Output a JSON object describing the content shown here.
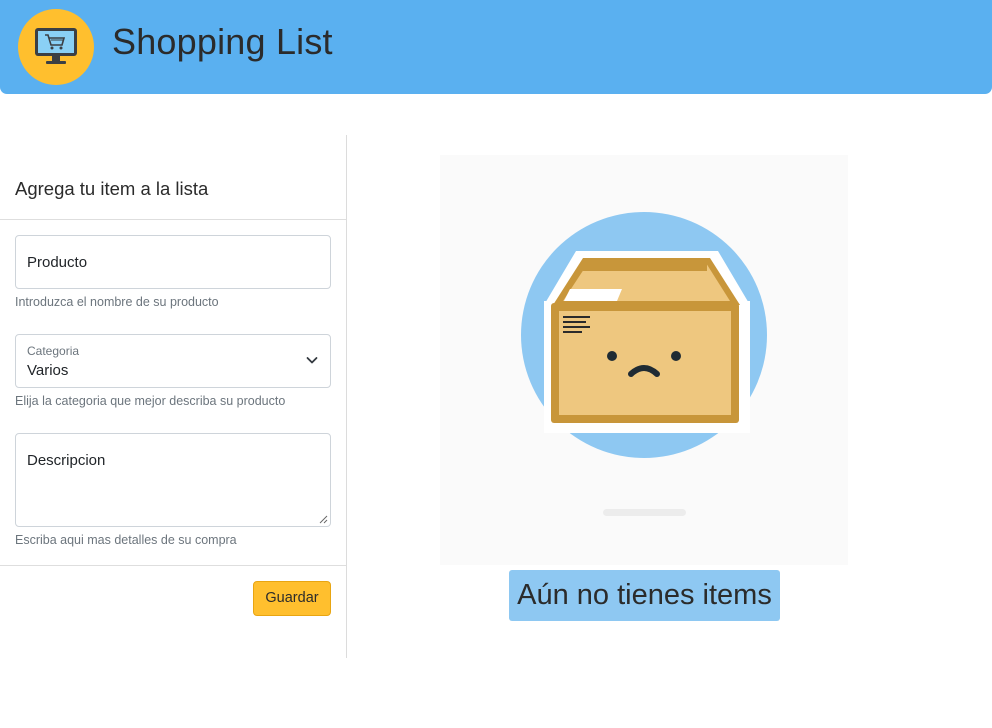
{
  "header": {
    "title": "Shopping List",
    "logo_icon": "shopping-cart-monitor-icon",
    "background_color": "#5ab0f0",
    "logo_color": "#ffbf2e"
  },
  "form": {
    "title": "Agrega tu item a la lista",
    "product": {
      "placeholder": "Producto",
      "help": "Introduzca el nombre de su producto"
    },
    "category": {
      "label": "Categoria",
      "selected": "Varios",
      "help": "Elija la categoria que mejor describa su producto"
    },
    "description": {
      "placeholder": "Descripcion",
      "help": "Escriba aqui mas detalles de su compra"
    },
    "save_label": "Guardar",
    "save_color": "#ffbf2e"
  },
  "empty_state": {
    "icon": "sad-box-icon",
    "message": "Aún no tienes items",
    "message_bg": "#8ec8f2"
  }
}
